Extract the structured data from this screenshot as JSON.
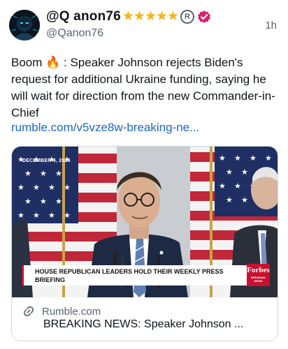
{
  "post": {
    "display_name": "@Q anon76",
    "stars": "★★★★★",
    "registered_mark": "R",
    "handle": "@Qanon76",
    "timestamp": "1h",
    "text": "Boom 🔥 : Speaker Johnson rejects Biden's request for additional Ukraine funding, saying he will wait for direction from the new Commander-in-Chief",
    "link": "rumble.com/v5vze8w-breaking-ne..."
  },
  "card": {
    "image": {
      "date": "DECEMBER 4, 2024",
      "banner": "HOUSE REPUBLICAN LEADERS HOLD THEIR WEEKLY PRESS BRIEFING",
      "logo": "Forbes",
      "logo_sub": "BREAKING NEWS"
    },
    "domain": "Rumble.com",
    "title": "BREAKING NEWS: Speaker Johnson ..."
  },
  "colors": {
    "link": "#1d67c8",
    "secondary_text": "#536471",
    "star": "#f5b418",
    "verified": "#d6246e",
    "forbes_red": "#c8102e"
  },
  "icons": {
    "verified": "verified-badge-icon",
    "link": "link-icon",
    "registered": "registered-icon"
  }
}
